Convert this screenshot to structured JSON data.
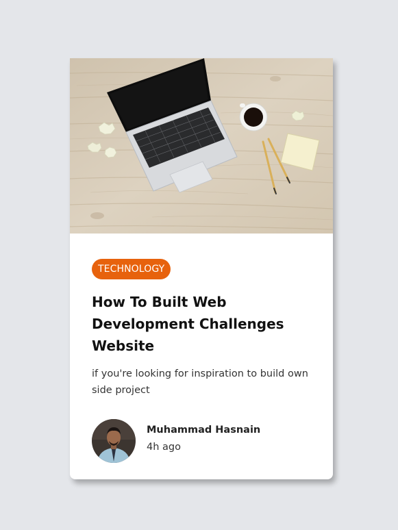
{
  "card": {
    "image_alt": "laptop-coffee-desk-photo",
    "tag": "TECHNOLOGY",
    "title": "How To Built Web Development Challenges Website",
    "description": "if you're looking for inspiration to build own side project",
    "author": {
      "name": "Muhammad Hasnain",
      "time": "4h ago"
    }
  },
  "colors": {
    "page_background": "#e4e6ea",
    "card_background": "#ffffff",
    "tag_background": "#e7620d",
    "tag_text": "#ffffff",
    "title_text": "#111111"
  }
}
